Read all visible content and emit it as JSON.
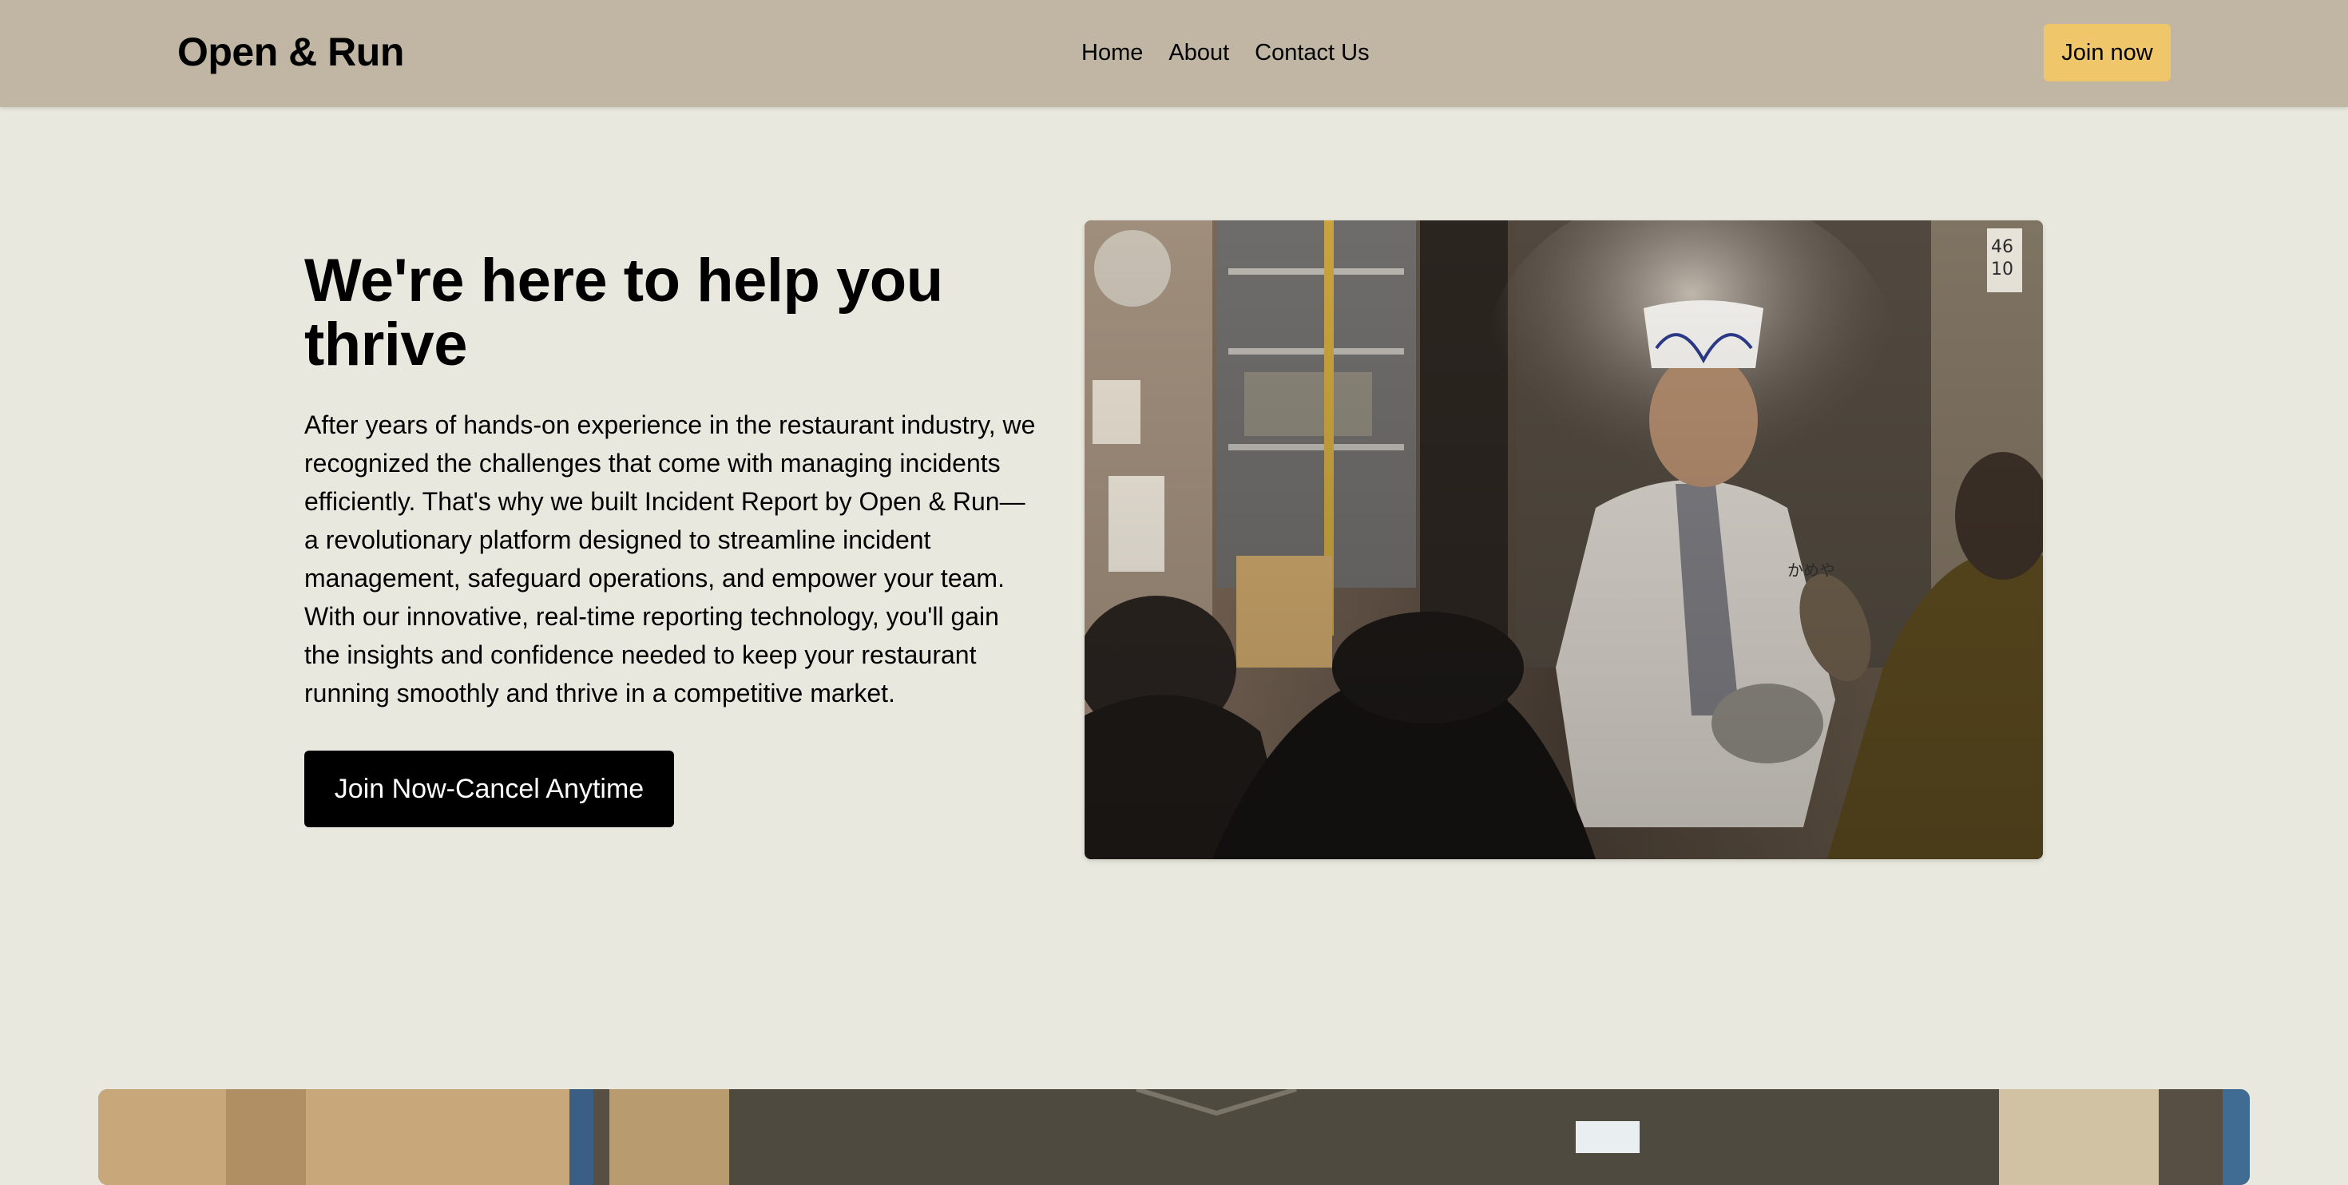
{
  "navbar": {
    "brand": "Open & Run",
    "links": [
      "Home",
      "About",
      "Contact Us"
    ],
    "join_label": "Join now"
  },
  "hero": {
    "title": "We're here to help you thrive",
    "body": "After years of hands-on experience in the restaurant industry, we recognized the challenges that come with managing incidents efficiently. That's why we built Incident Report by Open & Run—a revolutionary platform designed to streamline incident management, safeguard operations, and empower your team. With our innovative, real-time reporting technology, you'll gain the insights and confidence needed to keep your restaurant running smoothly and thrive in a competitive market.",
    "cta_label": "Join Now-Cancel Anytime",
    "photo": {
      "subject": "chef-in-kitchen-photo",
      "jacket_text": "かめや",
      "sign_text": [
        "46",
        "10"
      ]
    }
  },
  "section2": {
    "photo_subject": "warehouse-photo"
  },
  "colors": {
    "page_bg": "#e8e8de",
    "navbar_bg": "#c1b6a3",
    "join_button_bg": "#efc669",
    "cta_bg": "#000000",
    "cta_text": "#ffffff"
  }
}
